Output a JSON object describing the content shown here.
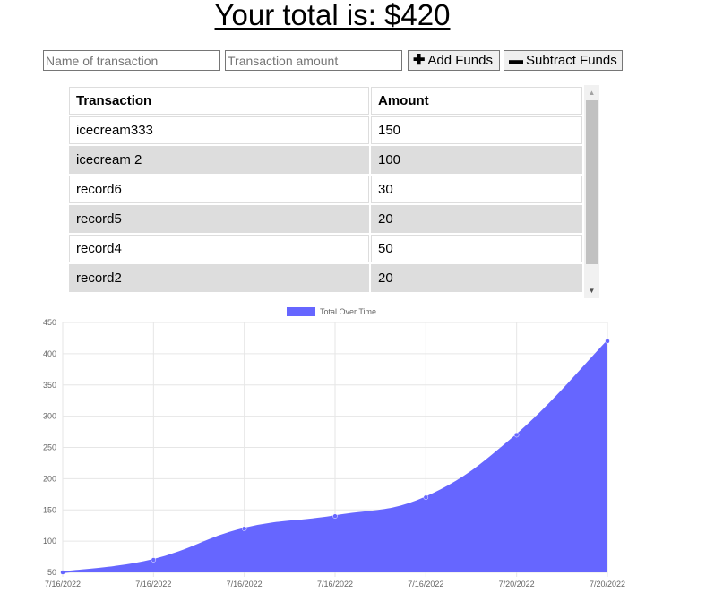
{
  "header": {
    "total_text": "Your total is: $420"
  },
  "form": {
    "name_placeholder": "Name of transaction",
    "amount_placeholder": "Transaction amount",
    "add_label": "Add Funds",
    "subtract_label": "Subtract Funds",
    "add_icon": "plus-icon",
    "subtract_icon": "minus-icon"
  },
  "table": {
    "headers": [
      "Transaction",
      "Amount"
    ],
    "rows": [
      {
        "name": "icecream333",
        "amount": "150"
      },
      {
        "name": "icecream 2",
        "amount": "100"
      },
      {
        "name": "record6",
        "amount": "30"
      },
      {
        "name": "record5",
        "amount": "20"
      },
      {
        "name": "record4",
        "amount": "50"
      },
      {
        "name": "record2",
        "amount": "20"
      }
    ]
  },
  "chart_data": {
    "type": "area",
    "categories": [
      "7/16/2022",
      "7/16/2022",
      "7/16/2022",
      "7/16/2022",
      "7/16/2022",
      "7/20/2022",
      "7/20/2022"
    ],
    "series": [
      {
        "name": "Total Over Time",
        "values": [
          50,
          70,
          120,
          140,
          170,
          270,
          420
        ],
        "color": "#6666ff"
      }
    ],
    "ylim": [
      50,
      450
    ],
    "yticks": [
      50,
      100,
      150,
      200,
      250,
      300,
      350,
      400,
      450
    ],
    "grid": true,
    "legend": "top-center"
  }
}
